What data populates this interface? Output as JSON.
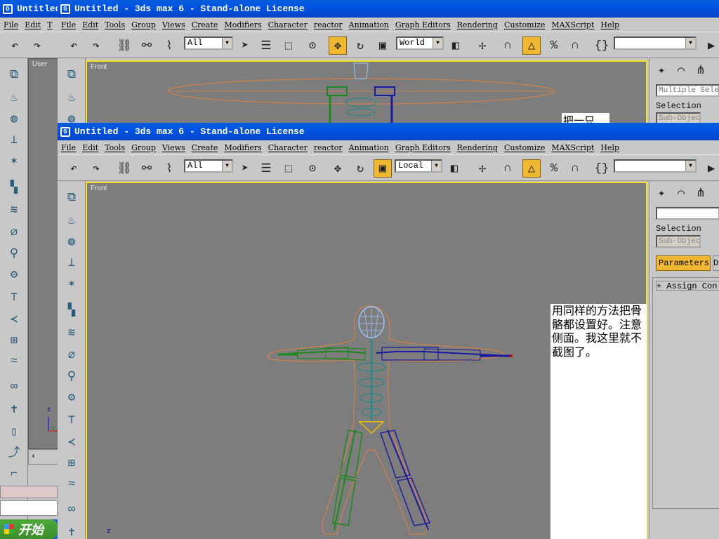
{
  "windows": {
    "back": {
      "title": "Untitled"
    },
    "middle": {
      "title": "Untitled - 3ds max 6 - Stand-alone License",
      "selection_filter": "All",
      "ref_coord": "World",
      "viewport_label": "Front",
      "left_viewport_label": "User",
      "partial_note": "把一只",
      "cmd": {
        "field1": "Multiple Sele",
        "selection_label": "Selection",
        "subobject": "Sub-Object"
      }
    },
    "front": {
      "title": "Untitled - 3ds max 6 - Stand-alone License",
      "selection_filter": "All",
      "ref_coord": "Local",
      "viewport_label": "Front",
      "cmd": {
        "field1": "",
        "selection_label": "Selection",
        "subobject": "Sub-Object",
        "rollout_tab": "Parameters",
        "rollout_tab2": "D",
        "assign": "+ Assign Con"
      }
    }
  },
  "menu": [
    "File",
    "Edit",
    "Tools",
    "Group",
    "Views",
    "Create",
    "Modifiers",
    "Character",
    "reactor",
    "Animation",
    "Graph Editors",
    "Rendering",
    "Customize",
    "MAXScript",
    "Help"
  ],
  "back_menu": [
    "File",
    "Edit",
    "T"
  ],
  "note_text": "用同样的方法把骨骼都设置好。注意侧面。我这里就不截图了。",
  "taskbar": {
    "start_label": "开始"
  },
  "colors": {
    "viewport_bg": "#7d7d7d",
    "active_border": "#f5e028",
    "titlebar": "#0054e3",
    "skin": "#e08040",
    "bone_left": "#1a8a1a",
    "bone_right": "#1a1aa0",
    "spine": "#1a8a8a",
    "head": "#a0c8ff"
  },
  "icons": [
    "undo-icon",
    "redo-icon",
    "link-icon",
    "unlink-icon",
    "bind-space-warp-icon",
    "select-object-icon",
    "select-by-name-icon",
    "rectangular-region-icon",
    "window-crossing-icon",
    "move-icon",
    "rotate-icon",
    "scale-icon",
    "pivot-icon",
    "manipulate-icon",
    "snap-3d-icon",
    "angle-snap-icon",
    "percent-snap-icon",
    "spinner-snap-icon",
    "named-selection-icon",
    "mirror-icon",
    "create-icon",
    "modify-icon",
    "hierarchy-icon",
    "motion-icon"
  ]
}
